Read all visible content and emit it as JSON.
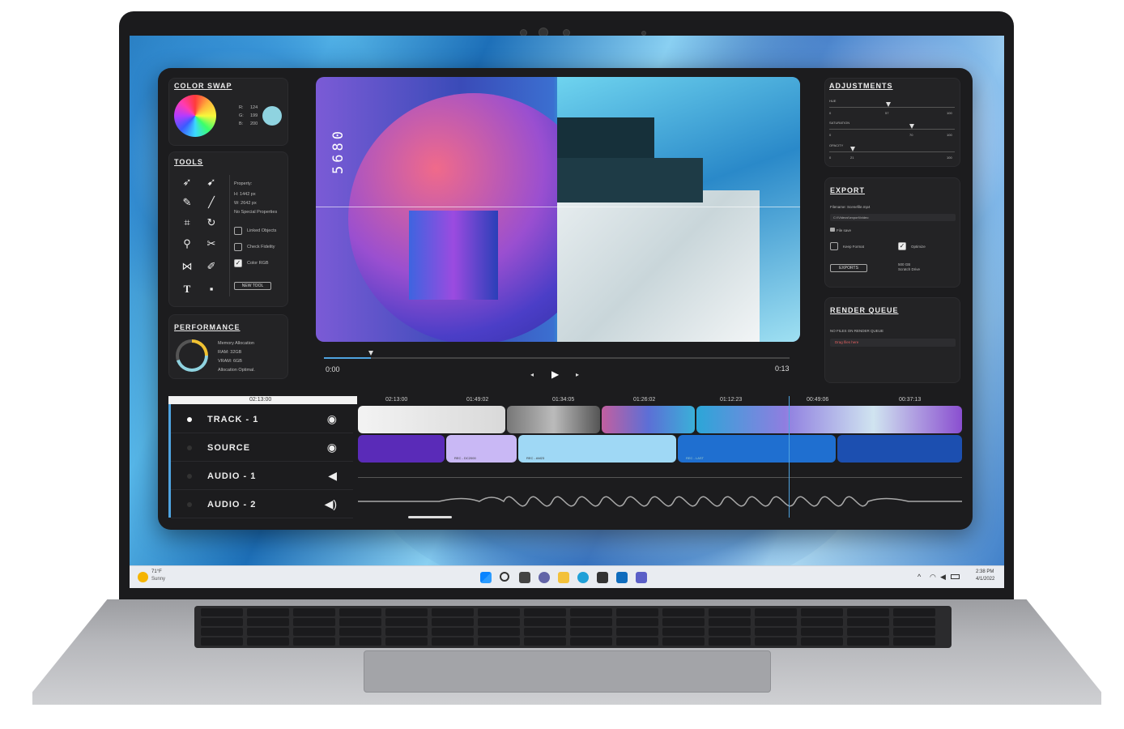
{
  "color_swap": {
    "title": "COLOR SWAP",
    "r_label": "R:",
    "r_value": "124",
    "g_label": "G:",
    "g_value": "199",
    "b_label": "B:",
    "b_value": "200",
    "swatch_color": "#8fd3e0"
  },
  "tools": {
    "title": "TOOLS",
    "property_label": "Property:",
    "h_value": "H: 1442 px",
    "w_value": "W: 2642 px",
    "special": "No Special Properties",
    "linked": "Linked Objects",
    "check_fidelity": "Check Fidelity",
    "color_rgb": "Color RGB",
    "new_tool": "NEW TOOL",
    "icons": [
      "select-arrow-icon",
      "direct-select-icon",
      "pen-icon",
      "brush-icon",
      "crop-icon",
      "rotate-icon",
      "zoom-icon",
      "scissors-icon",
      "mirror-icon",
      "dropper-icon",
      "text-tool-icon",
      "shape-tool-icon"
    ]
  },
  "performance": {
    "title": "PERFORMANCE",
    "memory": "Memory Allocation",
    "ram": "RAM: 32GB",
    "vram": "VRAM: 6GB",
    "status": "Allocation Optimal."
  },
  "preview": {
    "side_text": "5680",
    "time_start": "0:00",
    "time_end": "0:13",
    "progress": 0.1
  },
  "adjustments": {
    "title": "ADJUSTMENTS",
    "sliders": [
      {
        "label": "HUE",
        "min": "0",
        "value": "57",
        "max": "100"
      },
      {
        "label": "SATURATION",
        "min": "0",
        "value": "70",
        "max": "100"
      },
      {
        "label": "OPACITY",
        "min": "0",
        "value": "21",
        "max": "100"
      }
    ]
  },
  "export": {
    "title": "EXPORT",
    "filename": "Filename: Scenefile.mp4",
    "path": "C:\\\\Videos\\\\export\\\\video",
    "file_save": "File save",
    "keep_format": "Keep Format",
    "optimize": "Optimize",
    "export_btn": "EXPORTS",
    "size_info": "500 GB",
    "size_info2": "Scratch Drive"
  },
  "render_queue": {
    "title": "RENDER QUEUE",
    "empty": "NO FILES ON RENDER QUEUE",
    "drop": "Drag files here"
  },
  "timeline": {
    "header_time": "02:13:00",
    "timecodes": [
      "02:13:00",
      "01:49:02",
      "01:34:05",
      "01:26:02",
      "01:12:23",
      "00:49:06",
      "00:37:13"
    ],
    "tracks": [
      {
        "label": "TRACK - 1",
        "icon": "eye-icon"
      },
      {
        "label": "SOURCE",
        "icon": "eye-icon"
      },
      {
        "label": "AUDIO - 1",
        "icon": "speaker-icon"
      },
      {
        "label": "AUDIO - 2",
        "icon": "speaker-loud-icon"
      }
    ],
    "clip_labels": [
      "REC - DC2000",
      "REC - AM23",
      "REC - LAST"
    ]
  },
  "taskbar": {
    "weather_temp": "71°F",
    "weather_desc": "Sunny",
    "time": "2:38 PM",
    "date": "4/1/2022"
  }
}
